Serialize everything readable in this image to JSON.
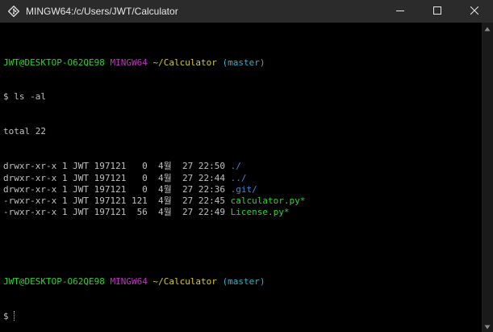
{
  "window": {
    "title": "MINGW64:/c/Users/JWT/Calculator"
  },
  "icons": {
    "app": "git-bash-diamond-icon",
    "minimize": "minimize-icon",
    "maximize": "maximize-icon",
    "close": "close-icon",
    "scroll_up": "triangle-up-icon",
    "scroll_down": "triangle-down-icon"
  },
  "colors": {
    "user_host": "#2fd12f",
    "shell": "#c034c0",
    "path": "#d2c832",
    "branch": "#2cb4c8",
    "directory": "#3a86d8",
    "executable": "#2fd12f"
  },
  "prompt": {
    "user_host": "JWT@DESKTOP-O62QE98",
    "shell": "MINGW64",
    "path": "~/Calculator",
    "branch": "(master)",
    "symbol": "$"
  },
  "command": "ls -al",
  "total": "total 22",
  "listing": [
    {
      "perms": "drwxr-xr-x",
      "links": "1",
      "owner": "JWT",
      "group": "197121",
      "size": "0",
      "month": "4월",
      "day": "27",
      "time": "22:50",
      "name": "./",
      "kind": "dir"
    },
    {
      "perms": "drwxr-xr-x",
      "links": "1",
      "owner": "JWT",
      "group": "197121",
      "size": "0",
      "month": "4월",
      "day": "27",
      "time": "22:44",
      "name": "../",
      "kind": "dir"
    },
    {
      "perms": "drwxr-xr-x",
      "links": "1",
      "owner": "JWT",
      "group": "197121",
      "size": "0",
      "month": "4월",
      "day": "27",
      "time": "22:36",
      "name": ".git/",
      "kind": "dir"
    },
    {
      "perms": "-rwxr-xr-x",
      "links": "1",
      "owner": "JWT",
      "group": "197121",
      "size": "121",
      "month": "4월",
      "day": "27",
      "time": "22:45",
      "name": "calculator.py*",
      "kind": "exec"
    },
    {
      "perms": "-rwxr-xr-x",
      "links": "1",
      "owner": "JWT",
      "group": "197121",
      "size": "56",
      "month": "4월",
      "day": "27",
      "time": "22:49",
      "name": "License.py*",
      "kind": "exec"
    }
  ]
}
